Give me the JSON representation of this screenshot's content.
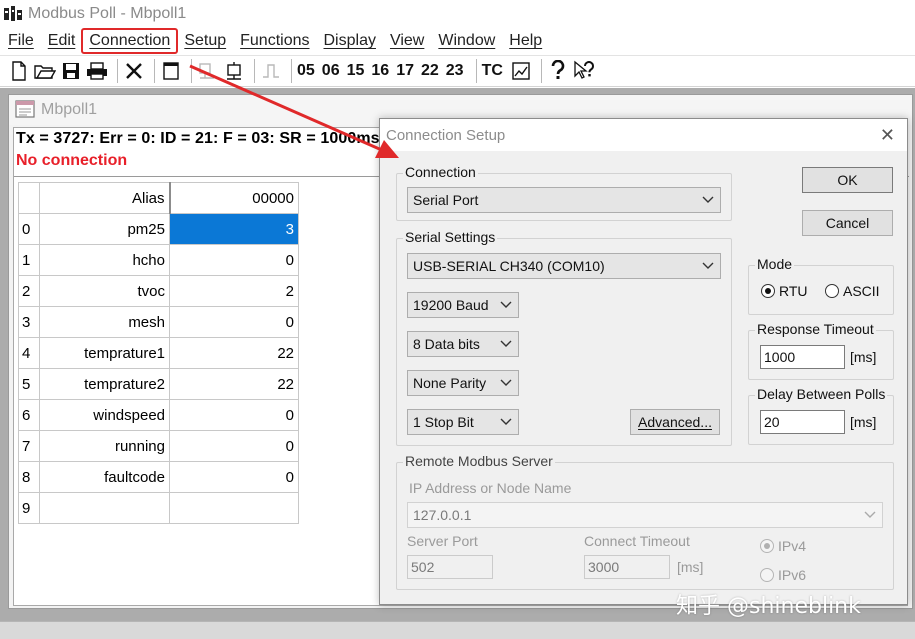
{
  "app": {
    "title": "Modbus Poll - Mbpoll1"
  },
  "menu": [
    {
      "label": "File"
    },
    {
      "label": "Edit"
    },
    {
      "label": "Connection"
    },
    {
      "label": "Setup"
    },
    {
      "label": "Functions"
    },
    {
      "label": "Display"
    },
    {
      "label": "View"
    },
    {
      "label": "Window"
    },
    {
      "label": "Help"
    }
  ],
  "toolbar": {
    "codes": [
      "05",
      "06",
      "15",
      "16",
      "17",
      "22",
      "23"
    ],
    "tc_label": "TC"
  },
  "child": {
    "title": "Mbpoll1",
    "status_line": "Tx = 3727: Err = 0: ID = 21: F = 03: SR = 1000ms",
    "connection_status": "No connection",
    "grid": {
      "headers": {
        "alias": "Alias",
        "value": "00000"
      },
      "rows": [
        {
          "index": "0",
          "alias": "pm25",
          "value": "3"
        },
        {
          "index": "1",
          "alias": "hcho",
          "value": "0"
        },
        {
          "index": "2",
          "alias": "tvoc",
          "value": "2"
        },
        {
          "index": "3",
          "alias": "mesh",
          "value": "0"
        },
        {
          "index": "4",
          "alias": "temprature1",
          "value": "22"
        },
        {
          "index": "5",
          "alias": "temprature2",
          "value": "22"
        },
        {
          "index": "6",
          "alias": "windspeed",
          "value": "0"
        },
        {
          "index": "7",
          "alias": "running",
          "value": "0"
        },
        {
          "index": "8",
          "alias": "faultcode",
          "value": "0"
        },
        {
          "index": "9",
          "alias": "",
          "value": ""
        }
      ]
    }
  },
  "dialog": {
    "title": "Connection Setup",
    "connection_group": "Connection",
    "connection_value": "Serial Port",
    "serial_group": "Serial Settings",
    "port_value": "USB-SERIAL CH340 (COM10)",
    "baud_value": "19200 Baud",
    "data_bits_value": "8 Data bits",
    "parity_value": "None Parity",
    "stop_bits_value": "1 Stop Bit",
    "advanced_label": "Advanced...",
    "ok_label": "OK",
    "cancel_label": "Cancel",
    "mode_group": "Mode",
    "mode_rtu": "RTU",
    "mode_ascii": "ASCII",
    "response_timeout_group": "Response Timeout",
    "response_timeout_value": "1000",
    "response_timeout_unit": "[ms]",
    "delay_group": "Delay Between Polls",
    "delay_value": "20",
    "delay_unit": "[ms]",
    "remote_group": "Remote Modbus Server",
    "ip_label": "IP Address or Node Name",
    "ip_value": "127.0.0.1",
    "server_port_label": "Server Port",
    "server_port_value": "502",
    "connect_timeout_label": "Connect Timeout",
    "connect_timeout_value": "3000",
    "connect_timeout_unit": "[ms]",
    "ipv4_label": "IPv4",
    "ipv6_label": "IPv6"
  },
  "watermark": "知乎 @shineblink",
  "colors": {
    "highlight_red": "#e0292a",
    "selection_blue": "#0b78d6",
    "error_red": "#e8202a"
  }
}
